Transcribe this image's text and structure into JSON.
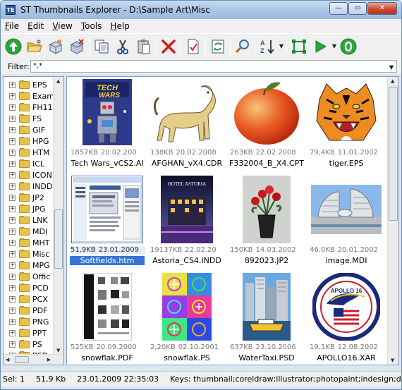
{
  "window": {
    "title": "ST Thumbnails Explorer - D:\\Sample Art\\Misc",
    "app_icon_text": "TE"
  },
  "window_buttons": {
    "minimize": "—",
    "maximize": "▭",
    "close": "✕"
  },
  "menu": [
    {
      "label": "File"
    },
    {
      "label": "Edit"
    },
    {
      "label": "View"
    },
    {
      "label": "Tools"
    },
    {
      "label": "Help"
    }
  ],
  "filter": {
    "label": "Filter:",
    "value": "*.*"
  },
  "tree": {
    "items": [
      {
        "label": "EPS"
      },
      {
        "label": "Exam"
      },
      {
        "label": "FH11"
      },
      {
        "label": "FS"
      },
      {
        "label": "GIF"
      },
      {
        "label": "HPG"
      },
      {
        "label": "HTM"
      },
      {
        "label": "ICL"
      },
      {
        "label": "ICON"
      },
      {
        "label": "INDD"
      },
      {
        "label": "JP2"
      },
      {
        "label": "JPG"
      },
      {
        "label": "LNK"
      },
      {
        "label": "MDI"
      },
      {
        "label": "MHT"
      },
      {
        "label": "Misc"
      },
      {
        "label": "MPG"
      },
      {
        "label": "Offic"
      },
      {
        "label": "PCD"
      },
      {
        "label": "PCX"
      },
      {
        "label": "PDF"
      },
      {
        "label": "PNG"
      },
      {
        "label": "PPT"
      },
      {
        "label": "PS"
      },
      {
        "label": "PSD"
      }
    ]
  },
  "files": [
    {
      "size": "1857KB",
      "date": "20.02.200",
      "name": "Tech Wars_vCS2.AI",
      "thumb": "techwars"
    },
    {
      "size": "138KB",
      "date": "20.02.2008",
      "name": "AFGHAN_vX4.CDR",
      "thumb": "dog"
    },
    {
      "size": "263KB",
      "date": "22.02.2008",
      "name": "F332004_B_X4.CPT",
      "thumb": "peach"
    },
    {
      "size": "79,4KB",
      "date": "11.01.2002",
      "name": "tiger.EPS",
      "thumb": "tiger"
    },
    {
      "size": "51,9KB",
      "date": "23.01.2009",
      "name": "Softfields.htm",
      "thumb": "webpage",
      "selected": true
    },
    {
      "size": "19137KB",
      "date": "22.02.20",
      "name": "Astoria_CS4.INDD",
      "thumb": "hotel",
      "caption": "HOTEL ASTORIA"
    },
    {
      "size": "150KB",
      "date": "14.03.2002",
      "name": "892023.JP2",
      "thumb": "flowers"
    },
    {
      "size": "46,0KB",
      "date": "20.01.2002",
      "name": "image.MDI",
      "thumb": "cityhall"
    },
    {
      "size": "525KB",
      "date": "20.09.2000",
      "name": "snowflak.PDF",
      "thumb": "pdfpage"
    },
    {
      "size": "2,20KB",
      "date": "02.10.2001",
      "name": "snowflak.PS",
      "thumb": "snowflakes"
    },
    {
      "size": "637KB",
      "date": "23.10.2006",
      "name": "WaterTaxi.PSD",
      "thumb": "taxi"
    },
    {
      "size": "19,1KB",
      "date": "12.08.2002",
      "name": "APOLLO16.XAR",
      "thumb": "apollo",
      "caption": "APOLLO 16"
    }
  ],
  "status": {
    "selection": "Sel: 1",
    "size": "51,9 Kb",
    "datetime": "23.01.2009 22:35:03",
    "keys": "Keys: thumbnail;coreldraw;illustrator;photopaint;indesign;designe"
  }
}
